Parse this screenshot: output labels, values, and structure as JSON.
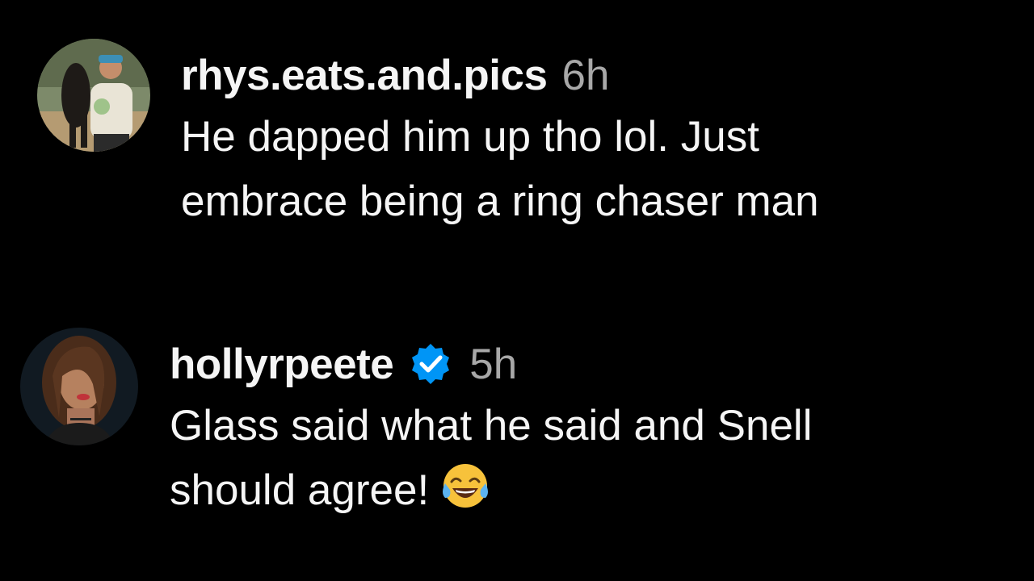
{
  "comments": [
    {
      "username": "rhys.eats.and.pics",
      "time": "6h",
      "verified": false,
      "lines": [
        "He dapped him up tho lol. Just",
        "embrace being a ring chaser man"
      ]
    },
    {
      "username": "hollyrpeete",
      "time": "5h",
      "verified": true,
      "lines": [
        "Glass said what he said and Snell",
        "should agree!"
      ],
      "emoji": "face-with-tears-of-joy"
    }
  ],
  "colors": {
    "background": "#000000",
    "text": "#f5f5f5",
    "timestamp": "#a8a8a8",
    "verified_badge": "#0095f6"
  }
}
